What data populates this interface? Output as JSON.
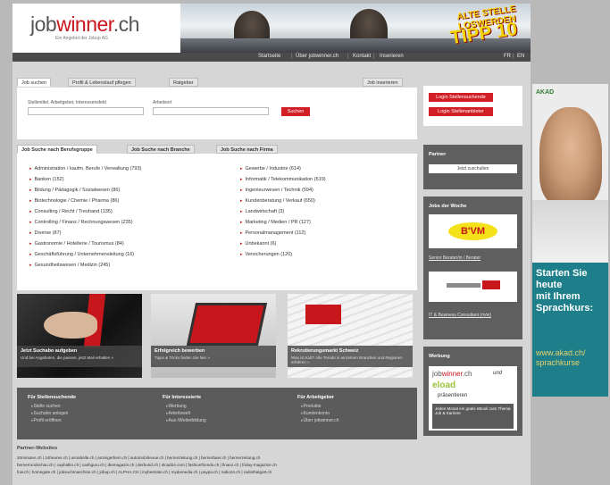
{
  "header": {
    "logo_prefix": "job",
    "logo_brand": "winner",
    "logo_suffix": ".ch",
    "logo_sub": "Ein Angebot der Jobup AG",
    "banner_line1": "ALTE STELLE LOSWERDEN",
    "banner_line2": "TIPP 10"
  },
  "nav": {
    "links": [
      "Startseite",
      "Über jobwinner.ch",
      "Kontakt",
      "Inserieren"
    ],
    "lang": [
      "FR",
      "EN"
    ]
  },
  "search": {
    "tabs": [
      "Job suchen",
      "Profil & Lebenslauf pflegen",
      "Ratgeber"
    ],
    "tab_right": "Job inserieren",
    "field1_label": "Stellentitel, Arbeitgeber, Interessensfeld",
    "field2_label": "Arbeitsort",
    "field1_value": "",
    "field2_value": "",
    "submit": "Suchen"
  },
  "login": {
    "job_seekers": "Login Stellensuchende",
    "employers": "Login Stellenanbieter"
  },
  "categories": {
    "tabs": [
      "Job Suche nach Berufsgruppe",
      "Job Suche nach Branche",
      "Job Suche nach Firma"
    ],
    "left": [
      "Administration / kaufm. Berufe / Verwaltung (793)",
      "Banken (152)",
      "Bildung / Pädagogik / Sozialwesen (86)",
      "Biotechnologie / Chemie / Pharma (86)",
      "Consulting / Recht / Treuhand (135)",
      "Controlling / Finanz / Rechnungswesen (235)",
      "Diverse (87)",
      "Gastronomie / Hotellerie / Tourismus (84)",
      "Geschäftsführung / Unternehmensleitung (16)",
      "Gesundheitswesen / Medizin (245)"
    ],
    "right": [
      "Gewerbe / Industrie (614)",
      "Informatik / Telekommunikation (519)",
      "Ingenieurwesen / Technik (594)",
      "Kundenberatung / Verkauf (650)",
      "Landwirtschaft (3)",
      "Marketing / Medien / PR (127)",
      "Personalmanagement (112)",
      "Unbekannt (6)",
      "Versicherungen (120)"
    ]
  },
  "tiles": [
    {
      "title": "Jetzt Suchabo aufgeben",
      "sub": "Und bei Angeboten, die passen, jetzt Mail erhalten »"
    },
    {
      "title": "Erfolgreich bewerben",
      "sub": "Tipps & Tricks finden Sie hier »"
    },
    {
      "title": "Rekrutierungsmarkt Schweiz",
      "sub": "Was ist Kult? Alle Trends in einzelnen Branchen und Regionen erfahren »"
    }
  ],
  "footer_cols": [
    {
      "head": "Für Stellensuchende",
      "links": [
        "Stelle suchen",
        "Suchabo anlegen",
        "Profil eröffnen"
      ]
    },
    {
      "head": "Für Interessierte",
      "links": [
        "Werbung",
        "Arbeitswelt",
        "Aus-/Weiterbildung"
      ]
    },
    {
      "head": "Für Arbeitgeber",
      "links": [
        "Produkte",
        "Kundenkonto",
        "Über jobwinner.ch"
      ]
    }
  ],
  "partner_sites": {
    "head": "Partner-Websites",
    "lines": [
      "20minuten.ch | 24heures.ch | annabelle.ch | anzeigerbern.ch | automobilrevue.ch | bernerzeitung.ch | bernerbaer.ch | bernerzeitung.ch",
      "bernerrundschau.ch | caphaltin.ch | cashguru.ch | diemagazin.ch | derbund.ch | elcad24.com | fashionfriends.ch | finanz.ch | friday-magazine.ch",
      "fuw.ch | homegate.ch | jobsuchmaschine.ch | jobup.ch | ALPHA.CH | mybestrate.ch | mydamedia.ch | paypa.ch | radio24.ch | radiothalgott.ch"
    ]
  },
  "sidebar": {
    "partner_head": "Partner",
    "partner_btn": "Jetzt zuschalten",
    "jobs_head": "Jobs der Woche",
    "job1_logo": "B'VM",
    "job1_link": "Senior Berater/in / Berater",
    "job2_link": "IT & Business Consultant (m/w)",
    "ad_head": "Werbung",
    "ad_brand_prefix": "job",
    "ad_brand": "winner",
    "ad_brand_suffix": ".ch",
    "ad_und": "und",
    "ad_eload": "eload",
    "ad_presents": "präsentieren",
    "ad_footer": "Jeden Monat ein gratis eBook zum Thema Job & Karriere"
  },
  "skyscraper": {
    "brand": "AKAD",
    "headline": [
      "Starten Sie",
      "heute",
      "mit Ihrem",
      "Sprachkurs:"
    ],
    "url_line1": "www.akad.ch/",
    "url_line2": "sprachkurse"
  },
  "colors": {
    "brand_red": "#c8161d",
    "dark_grey": "#5b5b5b",
    "page_bg": "#d6d6d6"
  }
}
